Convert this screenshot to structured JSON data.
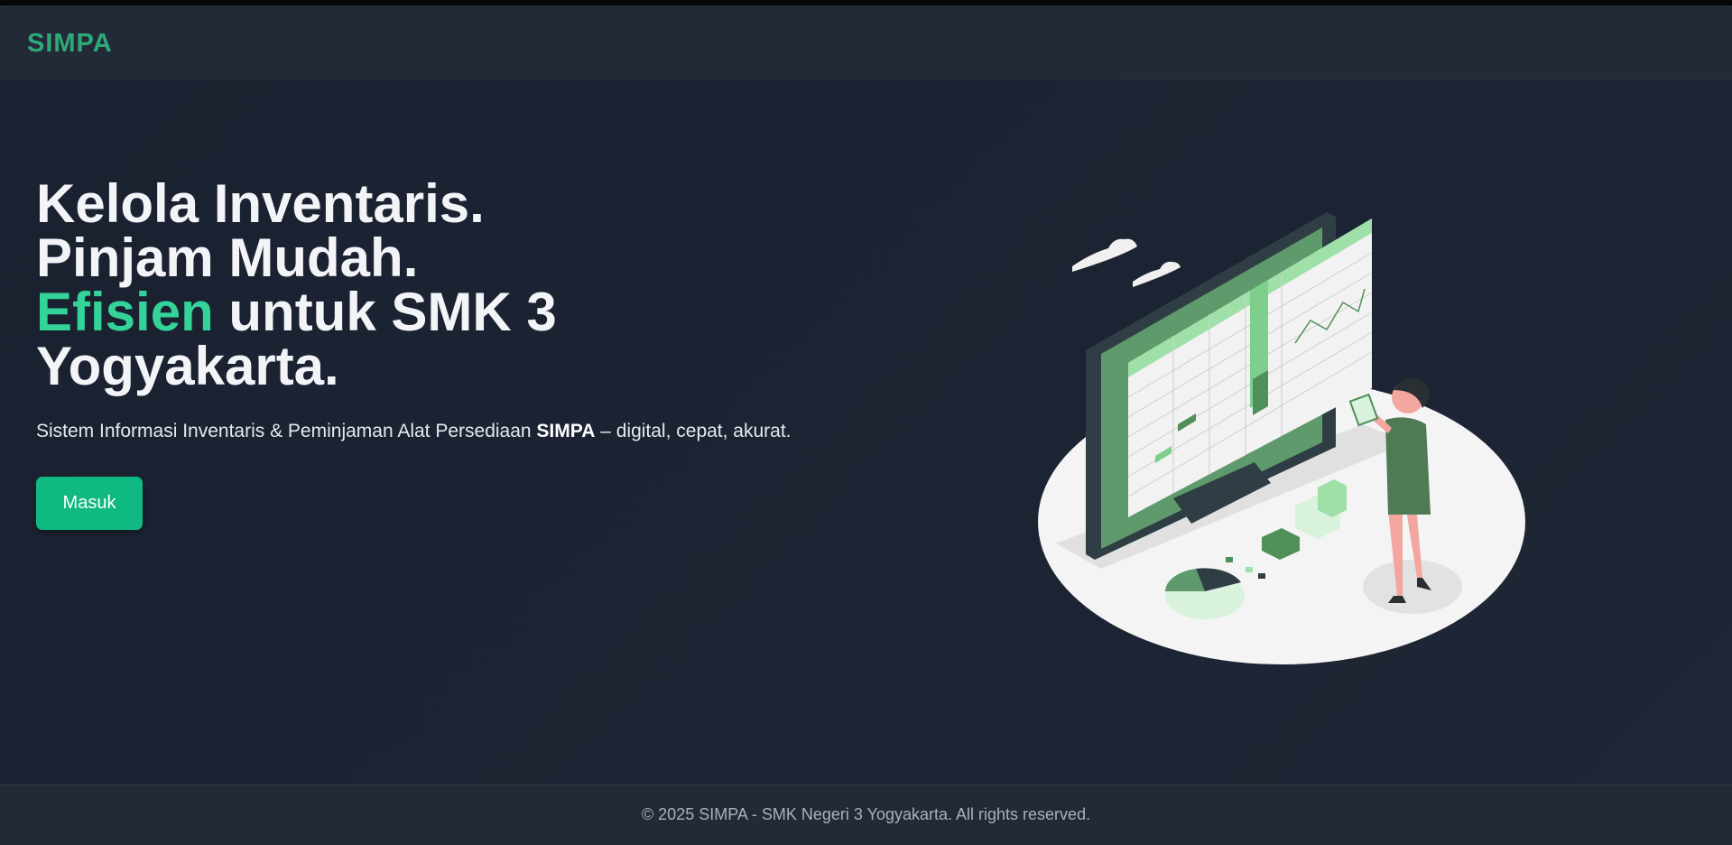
{
  "nav": {
    "brand": "SIMPA"
  },
  "hero": {
    "line1": "Kelola Inventaris.",
    "line2": "Pinjam Mudah.",
    "line3_accent": "Efisien",
    "line3_rest": " untuk SMK 3",
    "line4": "Yogyakarta.",
    "tagline_pre": "Sistem Informasi Inventaris & Peminjaman Alat Persediaan ",
    "tagline_bold": "SIMPA",
    "tagline_post": " – digital, cepat, akurat.",
    "button_label": "Masuk",
    "illustration_icon": "inventory-dashboard-illustration"
  },
  "footer": {
    "text": "© 2025 SIMPA - SMK Negeri 3 Yogyakarta. All rights reserved."
  },
  "colors": {
    "accent": "#34d399",
    "button": "#10b981",
    "brand": "#2fa878",
    "background": "#1b2230"
  }
}
